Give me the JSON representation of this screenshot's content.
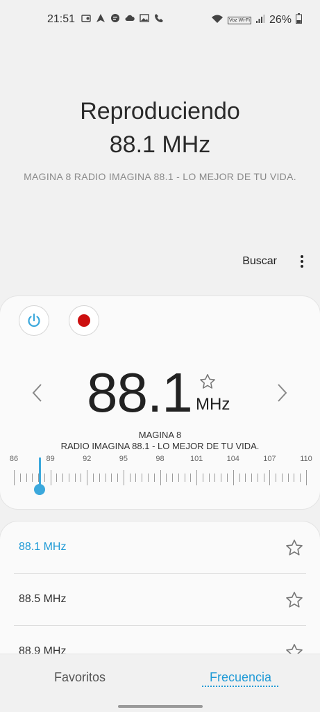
{
  "status_bar": {
    "time": "21:51",
    "battery": "26%",
    "icons": [
      "radio-icon",
      "navigation-icon",
      "chat-icon",
      "cloud-icon",
      "image-icon",
      "call-icon",
      "wifi-icon",
      "volte-icon",
      "signal-icon",
      "battery-icon"
    ],
    "vowifi": "Voz Wi-Fi"
  },
  "now_playing": {
    "title": "Reproduciendo",
    "frequency": "88.1 MHz",
    "station": "MAGINA 8 RADIO IMAGINA 88.1 - LO MEJOR DE TU VIDA."
  },
  "toolbar": {
    "search_label": "Buscar",
    "more_icon": "more-vert-icon"
  },
  "tuner": {
    "frequency": "88.1",
    "unit": "MHz",
    "rds_name": "MAGINA 8",
    "rds_text": "RADIO IMAGINA 88.1 - LO MEJOR DE TU VIDA.",
    "scale_labels": [
      "86",
      "89",
      "92",
      "95",
      "98",
      "101",
      "104",
      "107",
      "110"
    ],
    "current_value": 88.1,
    "accent_color": "#3ba8dc",
    "record_color": "#cc0f0f"
  },
  "station_list": [
    {
      "label": "88.1 MHz",
      "active": true
    },
    {
      "label": "88.5 MHz",
      "active": false
    },
    {
      "label": "88.9 MHz",
      "active": false
    }
  ],
  "tabs": {
    "favorites": "Favoritos",
    "frequency": "Frecuencia",
    "active": "frequency"
  }
}
